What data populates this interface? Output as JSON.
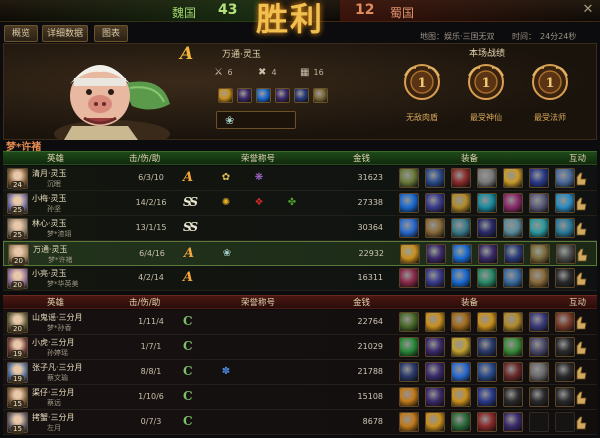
{
  "scoreboard": {
    "team_a": "魏国",
    "score_a": "43",
    "result": "胜利",
    "score_b": "12",
    "team_b": "蜀国",
    "close": "✕"
  },
  "tabs": [
    {
      "label": "概览"
    },
    {
      "label": "详细数据"
    },
    {
      "label": "图表"
    }
  ],
  "info": {
    "map": "地图：娱乐·三国无双",
    "time": "时间：　24分24秒"
  },
  "hero_card": {
    "rank": "A",
    "name": "万通·灵玉",
    "kills": "6",
    "deaths": "4",
    "assists": "16",
    "equip_colors": [
      "#c9901e",
      "#3a2a6a",
      "#1a6ad0",
      "#3a2a6a",
      "#2a3a7a",
      "#7a6a3a"
    ],
    "title_glyph": "❀"
  },
  "records": {
    "title": "本场战绩",
    "medals": [
      {
        "label": "无敌肉盾",
        "num": "1"
      },
      {
        "label": "最受神仙",
        "num": "1"
      },
      {
        "label": "最受法师",
        "num": "1"
      }
    ]
  },
  "team_title": "梦*许褚",
  "columns": {
    "hero": "英雄",
    "kda": "击/伤/助",
    "honor": "荣誉称号",
    "gold": "金钱",
    "equip": "装备",
    "interact": "互动"
  },
  "team_green": [
    {
      "hero": "清月·灵玉",
      "level": "24",
      "player": "沉眠",
      "kda": "6/3/10",
      "rank": "A",
      "rank_style": "a",
      "honors": [
        "✿",
        "❋"
      ],
      "honor_colors": [
        "#e0c050",
        "#b070e0"
      ],
      "gold": "31623",
      "portrait": "#7a5a3a",
      "equip": [
        "#6a7a3a",
        "#2a4a8a",
        "#8a2a2a",
        "#7a7a7a",
        "#c99a2a",
        "#2a3a8a",
        "#4a6a9a"
      ]
    },
    {
      "hero": "小梅·灵玉",
      "level": "25",
      "player": "孙坚",
      "kda": "14/2/16",
      "rank": "SS",
      "rank_style": "ss",
      "honors": [
        "✺",
        "❖",
        "✤"
      ],
      "honor_colors": [
        "#e8b020",
        "#d02a2a",
        "#4aa02a"
      ],
      "gold": "27338",
      "portrait": "#6a6aa0",
      "equip": [
        "#1a6ad0",
        "#3a3a8a",
        "#b08a2a",
        "#1a8aa0",
        "#8a2a6a",
        "#5a5a7a",
        "#2a8ac0"
      ]
    },
    {
      "hero": "林心·灵玉",
      "level": "25",
      "player": "梦*渣翊",
      "kda": "13/1/15",
      "rank": "SS",
      "rank_style": "ss",
      "honors": [],
      "honor_colors": [],
      "gold": "30364",
      "portrait": "#8a7a6a",
      "equip": [
        "#2a6ad0",
        "#8a6a3a",
        "#3a7a8a",
        "#2a2a6a",
        "#5a8a9a",
        "#2a9aa0",
        "#2a7a9a"
      ]
    },
    {
      "hero": "万通·灵玉",
      "level": "20",
      "player": "梦*许褚",
      "kda": "6/4/16",
      "rank": "A",
      "rank_style": "a",
      "honors": [
        "❀"
      ],
      "honor_colors": [
        "#a7d0c8"
      ],
      "gold": "22932",
      "portrait": "#9a8060",
      "equip": [
        "#c9901e",
        "#3a2a6a",
        "#1a6ad0",
        "#3a2a6a",
        "#2a3a7a",
        "#7a6a3a",
        "#4a4a4a"
      ],
      "mine": true
    },
    {
      "hero": "小亮·灵玉",
      "level": "20",
      "player": "梦*华英美",
      "kda": "4/2/14",
      "rank": "A",
      "rank_style": "a",
      "honors": [],
      "honor_colors": [],
      "gold": "16311",
      "portrait": "#8a6a9a",
      "equip": [
        "#8a2a4a",
        "#3a3a8a",
        "#1a6ad0",
        "#2a8a6a",
        "#3a6aa0",
        "#8a6a3a",
        "#2a2a2a"
      ]
    }
  ],
  "team_red": [
    {
      "hero": "山鬼谣·三分月",
      "level": "20",
      "player": "梦*孙香",
      "kda": "1/11/4",
      "rank": "C",
      "rank_style": "c",
      "honors": [],
      "honor_colors": [],
      "gold": "22764",
      "portrait": "#5a5a3a",
      "equip": [
        "#4a6a2a",
        "#c9901e",
        "#a06a1a",
        "#c9901e",
        "#b08a2a",
        "#3a3a7a",
        "#7a3a2a"
      ]
    },
    {
      "hero": "小虎·三分月",
      "level": "19",
      "player": "孙婷瑶",
      "kda": "1/7/1",
      "rank": "C",
      "rank_style": "c",
      "honors": [],
      "honor_colors": [],
      "gold": "21029",
      "portrait": "#6a3a3a",
      "equip": [
        "#2a8a3a",
        "#3a2a6a",
        "#c0a030",
        "#2a3a6a",
        "#3a8a3a",
        "#4a4a6a",
        "#2a2a2a"
      ]
    },
    {
      "hero": "张子凡·三分月",
      "level": "19",
      "player": "蔡文瑜",
      "kda": "8/8/1",
      "rank": "C",
      "rank_style": "c",
      "honors": [
        "✽"
      ],
      "honor_colors": [
        "#4a8ae0"
      ],
      "gold": "21788",
      "portrait": "#4a6a9a",
      "equip": [
        "#2a3a6a",
        "#3a2a6a",
        "#2a6ad0",
        "#2a4a8a",
        "#6a2a2a",
        "#6a6a6a",
        "#2a2a2a"
      ]
    },
    {
      "hero": "渠仔·三分月",
      "level": "15",
      "player": "蔡远",
      "kda": "1/10/6",
      "rank": "C",
      "rank_style": "c",
      "honors": [],
      "honor_colors": [],
      "gold": "15108",
      "portrait": "#7a5a3a",
      "equip": [
        "#c07a1a",
        "#3a2a6a",
        "#c9901e",
        "#2a3a8a",
        "#2a2a2a",
        "#2a2a2a",
        "#2a2a2a"
      ]
    },
    {
      "hero": "拷蟹·三分月",
      "level": "15",
      "player": "左月",
      "kda": "0/7/3",
      "rank": "C",
      "rank_style": "c",
      "honors": [],
      "honor_colors": [],
      "gold": "8678",
      "portrait": "#5a5a6a",
      "equip": [
        "#c07a1a",
        "#c9901e",
        "#2a6a3a",
        "#8a2a2a",
        "#3a2a6a",
        "empty",
        "empty"
      ]
    }
  ]
}
